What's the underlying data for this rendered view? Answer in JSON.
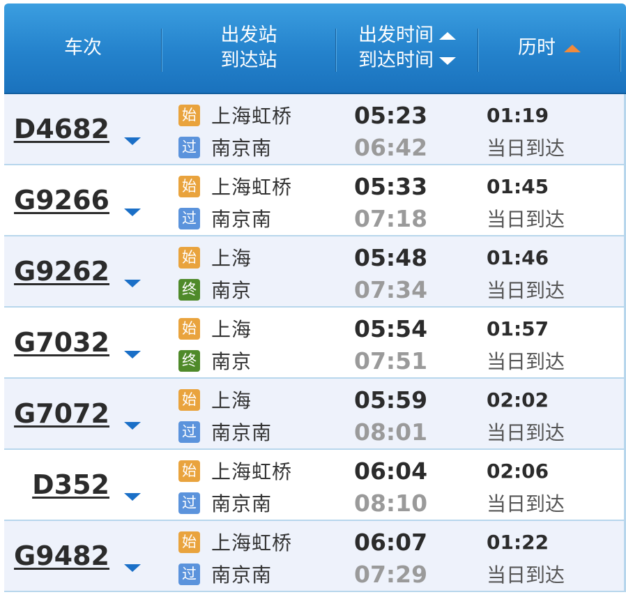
{
  "header": {
    "train_no": "车次",
    "from_station": "出发站",
    "to_station": "到达站",
    "depart_time": "出发时间",
    "arrive_time": "到达时间",
    "duration": "历时"
  },
  "colors": {
    "header_blue": "#2482cc",
    "sort_active": "#f08a3c",
    "badge_start": "#e9a33d",
    "badge_pass": "#5b93dc",
    "badge_end": "#4f8a2a",
    "expand_arrow": "#1a6fc7"
  },
  "icons": {
    "sort_up": "triangle-up-icon",
    "sort_down": "triangle-down-icon",
    "expand": "chevron-down-icon"
  },
  "trains": [
    {
      "train_no": "D4682",
      "from_badge": "始",
      "from_badge_type": "start",
      "from": "上海虹桥",
      "to_badge": "过",
      "to_badge_type": "pass",
      "to": "南京南",
      "depart": "05:23",
      "arrive": "06:42",
      "duration": "01:19",
      "arrive_day": "当日到达"
    },
    {
      "train_no": "G9266",
      "from_badge": "始",
      "from_badge_type": "start",
      "from": "上海虹桥",
      "to_badge": "过",
      "to_badge_type": "pass",
      "to": "南京南",
      "depart": "05:33",
      "arrive": "07:18",
      "duration": "01:45",
      "arrive_day": "当日到达"
    },
    {
      "train_no": "G9262",
      "from_badge": "始",
      "from_badge_type": "start",
      "from": "上海",
      "to_badge": "终",
      "to_badge_type": "end",
      "to": "南京",
      "depart": "05:48",
      "arrive": "07:34",
      "duration": "01:46",
      "arrive_day": "当日到达"
    },
    {
      "train_no": "G7032",
      "from_badge": "始",
      "from_badge_type": "start",
      "from": "上海",
      "to_badge": "终",
      "to_badge_type": "end",
      "to": "南京",
      "depart": "05:54",
      "arrive": "07:51",
      "duration": "01:57",
      "arrive_day": "当日到达"
    },
    {
      "train_no": "G7072",
      "from_badge": "始",
      "from_badge_type": "start",
      "from": "上海",
      "to_badge": "过",
      "to_badge_type": "pass",
      "to": "南京南",
      "depart": "05:59",
      "arrive": "08:01",
      "duration": "02:02",
      "arrive_day": "当日到达"
    },
    {
      "train_no": "D352",
      "from_badge": "始",
      "from_badge_type": "start",
      "from": "上海虹桥",
      "to_badge": "过",
      "to_badge_type": "pass",
      "to": "南京南",
      "depart": "06:04",
      "arrive": "08:10",
      "duration": "02:06",
      "arrive_day": "当日到达"
    },
    {
      "train_no": "G9482",
      "from_badge": "始",
      "from_badge_type": "start",
      "from": "上海虹桥",
      "to_badge": "过",
      "to_badge_type": "pass",
      "to": "南京南",
      "depart": "06:07",
      "arrive": "07:29",
      "duration": "01:22",
      "arrive_day": "当日到达"
    }
  ]
}
